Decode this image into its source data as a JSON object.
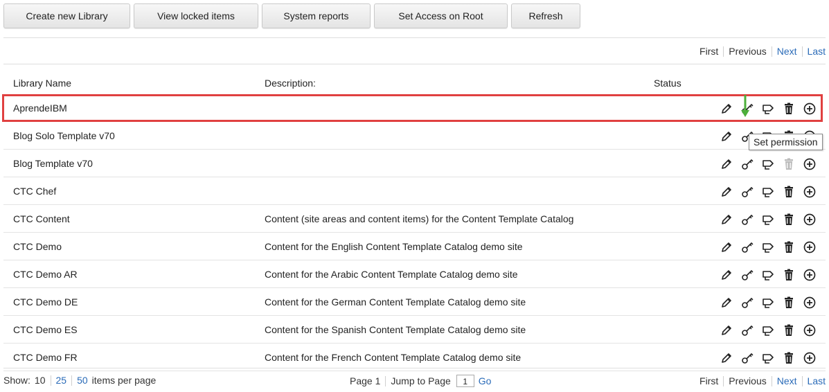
{
  "toolbar": {
    "buttons": [
      {
        "label": "Create new Library"
      },
      {
        "label": "View locked items"
      },
      {
        "label": "System reports"
      },
      {
        "label": "Set Access on Root"
      },
      {
        "label": "Refresh"
      }
    ]
  },
  "pager_top": {
    "first": "First",
    "previous": "Previous",
    "next": "Next",
    "last": "Last"
  },
  "table": {
    "headers": {
      "name": "Library Name",
      "description": "Description:",
      "status": "Status"
    },
    "rows": [
      {
        "name": "AprendeIBM",
        "description": ""
      },
      {
        "name": "Blog Solo Template v70",
        "description": ""
      },
      {
        "name": "Blog Template v70",
        "description": ""
      },
      {
        "name": "CTC Chef",
        "description": ""
      },
      {
        "name": "CTC Content",
        "description": "Content (site areas and content items) for the Content Template Catalog"
      },
      {
        "name": "CTC Demo",
        "description": "Content for the English Content Template Catalog demo site"
      },
      {
        "name": "CTC Demo AR",
        "description": "Content for the Arabic Content Template Catalog demo site"
      },
      {
        "name": "CTC Demo DE",
        "description": "Content for the German Content Template Catalog demo site"
      },
      {
        "name": "CTC Demo ES",
        "description": "Content for the Spanish Content Template Catalog demo site"
      },
      {
        "name": "CTC Demo FR",
        "description": "Content for the French Content Template Catalog demo site"
      }
    ],
    "row_actions": [
      "edit-icon",
      "set-permissions-icon",
      "export-icon",
      "delete-icon",
      "add-icon"
    ]
  },
  "tooltip": "Set permission",
  "footer": {
    "show_label": "Show:",
    "page_sizes": [
      "10",
      "25",
      "50"
    ],
    "items_label": "items per page",
    "page_label": "Page 1",
    "jump_label": "Jump to Page",
    "jump_value": "1",
    "go": "Go"
  },
  "pager_bottom": {
    "first": "First",
    "previous": "Previous",
    "next": "Next",
    "last": "Last"
  },
  "colors": {
    "link": "#2a6bb8",
    "highlight": "#e04040",
    "arrow": "#4caf3a"
  }
}
